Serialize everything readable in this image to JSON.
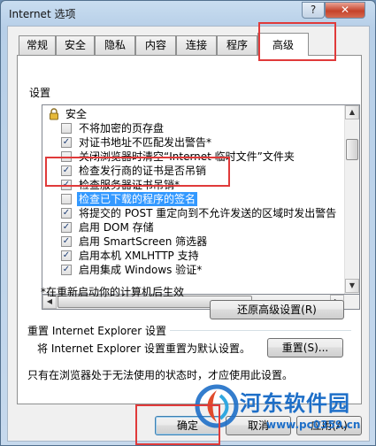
{
  "window": {
    "title": "Internet 选项",
    "help_label": "?",
    "close_label": "✕"
  },
  "tabs": [
    {
      "label": "常规"
    },
    {
      "label": "安全"
    },
    {
      "label": "隐私"
    },
    {
      "label": "内容"
    },
    {
      "label": "连接"
    },
    {
      "label": "程序"
    },
    {
      "label": "高级",
      "active": true
    }
  ],
  "settings": {
    "group_label": "设置",
    "category": "安全",
    "items": [
      {
        "label": "不将加密的页存盘",
        "checked": false
      },
      {
        "label": "对证书地址不匹配发出警告*",
        "checked": true
      },
      {
        "label": "关闭浏览器时清空“Internet 临时文件”文件夹",
        "checked": false
      },
      {
        "label": "检查发行商的证书是否吊销",
        "checked": true
      },
      {
        "label": "检查服务器证书吊销*",
        "checked": true
      },
      {
        "label": "检查已下载的程序的签名",
        "checked": false,
        "selected": true
      },
      {
        "label": "将提交的 POST 重定向到不允许发送的区域时发出警告",
        "checked": true
      },
      {
        "label": "启用 DOM 存储",
        "checked": true
      },
      {
        "label": "启用 SmartScreen 筛选器",
        "checked": true
      },
      {
        "label": "启用本机 XMLHTTP 支持",
        "checked": true
      },
      {
        "label": "启用集成 Windows 验证*",
        "checked": true
      }
    ]
  },
  "restart_note": "*在重新启动你的计算机后生效",
  "restore_button": "还原高级设置(R)",
  "reset_section": {
    "title": "重置 Internet Explorer 设置",
    "description": "将 Internet Explorer 设置重置为默认设置。",
    "button": "重置(S)...",
    "note": "只有在浏览器处于无法使用的状态时，才应使用此设置。"
  },
  "footer": {
    "ok": "确定",
    "cancel": "取消",
    "apply": "应用(A)"
  },
  "watermark": {
    "title": "河东软件园",
    "url": "www.pc0359.cn"
  }
}
